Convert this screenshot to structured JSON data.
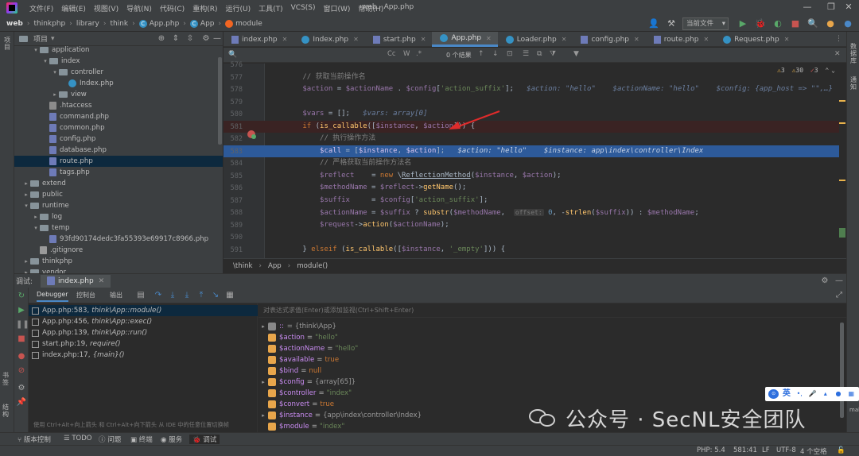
{
  "menu": {
    "items": [
      "文件(F)",
      "编辑(E)",
      "视图(V)",
      "导航(N)",
      "代码(C)",
      "重构(R)",
      "运行(U)",
      "工具(T)",
      "VCS(S)",
      "窗口(W)",
      "帮助(H)"
    ],
    "window_title": "web - App.php"
  },
  "nav": {
    "crumbs": [
      "web",
      "thinkphp",
      "library",
      "think",
      "App.php",
      "App",
      "module"
    ],
    "run_config": "当前文件"
  },
  "project_panel": {
    "title": "项目",
    "tree": [
      {
        "label": "application",
        "indent": 2,
        "kind": "folder",
        "arrow": "▾"
      },
      {
        "label": "index",
        "indent": 3,
        "kind": "folder",
        "arrow": "▾"
      },
      {
        "label": "controller",
        "indent": 4,
        "kind": "folder",
        "arrow": "▾"
      },
      {
        "label": "Index.php",
        "indent": 5,
        "kind": "class",
        "arrow": ""
      },
      {
        "label": "view",
        "indent": 4,
        "kind": "folder",
        "arrow": "▸"
      },
      {
        "label": ".htaccess",
        "indent": 3,
        "kind": "ht",
        "arrow": ""
      },
      {
        "label": "command.php",
        "indent": 3,
        "kind": "php",
        "arrow": ""
      },
      {
        "label": "common.php",
        "indent": 3,
        "kind": "php",
        "arrow": ""
      },
      {
        "label": "config.php",
        "indent": 3,
        "kind": "php",
        "arrow": ""
      },
      {
        "label": "database.php",
        "indent": 3,
        "kind": "php",
        "arrow": ""
      },
      {
        "label": "route.php",
        "indent": 3,
        "kind": "php",
        "arrow": "",
        "selected": true
      },
      {
        "label": "tags.php",
        "indent": 3,
        "kind": "php",
        "arrow": ""
      },
      {
        "label": "extend",
        "indent": 1,
        "kind": "folder",
        "arrow": "▸"
      },
      {
        "label": "public",
        "indent": 1,
        "kind": "folder",
        "arrow": "▸"
      },
      {
        "label": "runtime",
        "indent": 1,
        "kind": "folder",
        "arrow": "▾"
      },
      {
        "label": "log",
        "indent": 2,
        "kind": "folder",
        "arrow": "▸"
      },
      {
        "label": "temp",
        "indent": 2,
        "kind": "folder",
        "arrow": "▾"
      },
      {
        "label": "93fd90174dedc3fa55393e69917c8966.php",
        "indent": 3,
        "kind": "php",
        "arrow": ""
      },
      {
        "label": ".gitignore",
        "indent": 2,
        "kind": "git",
        "arrow": ""
      },
      {
        "label": "thinkphp",
        "indent": 1,
        "kind": "folder",
        "arrow": "▸"
      },
      {
        "label": "vendor",
        "indent": 1,
        "kind": "folder",
        "arrow": "▸"
      }
    ]
  },
  "editor": {
    "tabs": [
      {
        "label": "index.php",
        "kind": "php"
      },
      {
        "label": "Index.php",
        "kind": "class"
      },
      {
        "label": "start.php",
        "kind": "php"
      },
      {
        "label": "App.php",
        "kind": "class",
        "active": true
      },
      {
        "label": "Loader.php",
        "kind": "class"
      },
      {
        "label": "config.php",
        "kind": "php"
      },
      {
        "label": "route.php",
        "kind": "php"
      },
      {
        "label": "Request.php",
        "kind": "class"
      }
    ],
    "find": {
      "opt_cc": "Cc",
      "opt_w": "W",
      "opt_re": ".*",
      "results": "0 个结果"
    },
    "inspections": {
      "warnings": "3",
      "weak": "30",
      "errors": "3"
    },
    "lines": [
      {
        "num": "576",
        "html": ""
      },
      {
        "num": "577",
        "html": "        <span class='com'>// 获取当前操作名</span>"
      },
      {
        "num": "578",
        "html": "        <span class='var'>$action</span> = <span class='var'>$actionName</span> . <span class='var'>$config</span>[<span class='str'>'action_suffix'</span>];   <span class='inl'>$action: \"hello\"    $actionName: \"hello\"    $config: {app_host => \"\",…}</span>"
      },
      {
        "num": "579",
        "html": ""
      },
      {
        "num": "580",
        "html": "        <span class='var'>$vars</span> = [];   <span class='inl'>$vars: array[0]</span>"
      },
      {
        "num": "581",
        "html": "        <span class='kw'>if</span> (<span class='fn'>is_callable</span>([<span class='var'>$instance</span>, <span class='var'>$action</span>])) {",
        "kind": "bp"
      },
      {
        "num": "582",
        "html": "            <span class='com'>// 执行操作方法</span>"
      },
      {
        "num": "583",
        "html": "            <span class='var'>$call</span> = [<span class='var'>$instance</span>, <span class='var'>$action</span>];   <span class='inl'>$action: \"hello\"    $instance: app\\index\\controller\\Index</span>",
        "kind": "exec"
      },
      {
        "num": "584",
        "html": "            <span class='com'>// 严格获取当前操作方法名</span>"
      },
      {
        "num": "585",
        "html": "            <span class='var'>$reflect</span>    = <span class='kw'>new</span> \\<span style='text-decoration:underline'>ReflectionMethod</span>(<span class='var'>$instance</span>, <span class='var'>$action</span>);"
      },
      {
        "num": "586",
        "html": "            <span class='var'>$methodName</span> = <span class='var'>$reflect</span>-><span class='fn'>getName</span>();"
      },
      {
        "num": "587",
        "html": "            <span class='var'>$suffix</span>     = <span class='var'>$config</span>[<span class='str'>'action_suffix'</span>];"
      },
      {
        "num": "588",
        "html": "            <span class='var'>$actionName</span> = <span class='var'>$suffix</span> ? <span class='fn'>substr</span>(<span class='var'>$methodName</span>,  <span class='hint'>offset:</span> <span class='num'>0</span>, -<span class='fn'>strlen</span>(<span class='var'>$suffix</span>)) : <span class='var'>$methodName</span>;"
      },
      {
        "num": "589",
        "html": "            <span class='var'>$request</span>-><span class='fn'>action</span>(<span class='var'>$actionName</span>);"
      },
      {
        "num": "590",
        "html": ""
      },
      {
        "num": "591",
        "html": "        } <span class='kw'>elseif</span> (<span class='fn'>is_callable</span>([<span class='var'>$instance</span>, <span class='str'>'_empty'</span>])) {"
      }
    ],
    "bottom_crumbs": [
      "\\think",
      "App",
      "module()"
    ]
  },
  "debug": {
    "label": "调试:",
    "session_tab": "index.php",
    "tool_tabs": [
      "Debugger",
      "控制台",
      "输出"
    ],
    "frames": [
      {
        "loc": "App.php:583,",
        "fn": "think\\App::module()",
        "selected": true
      },
      {
        "loc": "App.php:456,",
        "fn": "think\\App::exec()"
      },
      {
        "loc": "App.php:139,",
        "fn": "think\\App::run()"
      },
      {
        "loc": "start.php:19,",
        "fn": "require()"
      },
      {
        "loc": "index.php:17,",
        "fn": "{main}()"
      }
    ],
    "frames_hint": "使用 Ctrl+Alt+向上箭头 和 Ctrl+Alt+向下箭头 从 IDE 中的任意位置切换帧",
    "watch_placeholder": "对表达式求值(Enter)或添加监视(Ctrl+Shift+Enter)",
    "variables": [
      {
        "name": "::",
        "value": "= {think\\App}",
        "arrow": "▸",
        "static": true,
        "vclass": "g"
      },
      {
        "name": "$action",
        "value": "\"hello\""
      },
      {
        "name": "$actionName",
        "value": "\"hello\""
      },
      {
        "name": "$available",
        "value": "true",
        "vclass": "k"
      },
      {
        "name": "$bind",
        "value": "null",
        "vclass": "k"
      },
      {
        "name": "$config",
        "value": "{array[65]}",
        "arrow": "▸",
        "vclass": "g"
      },
      {
        "name": "$controller",
        "value": "\"index\""
      },
      {
        "name": "$convert",
        "value": "true",
        "vclass": "k"
      },
      {
        "name": "$instance",
        "value": "{app\\index\\controller\\Index}",
        "arrow": "▸",
        "vclass": "g"
      },
      {
        "name": "$module",
        "value": "\"index\""
      }
    ]
  },
  "left_strip": {
    "top_label": "项目",
    "bottom_labels": [
      "书签",
      "结构"
    ]
  },
  "right_strip": {
    "labels": [
      "数据库",
      "通知",
      "make"
    ]
  },
  "ime": {
    "lang": "英"
  },
  "watermark": "公众号 · SecNL安全团队",
  "statusbar": {
    "items": [
      "版本控制",
      "TODO",
      "问题",
      "终端",
      "服务",
      "调试"
    ],
    "right": [
      "PHP: 5.4",
      "581:41",
      "LF",
      "UTF-8",
      "4 个空格"
    ]
  }
}
